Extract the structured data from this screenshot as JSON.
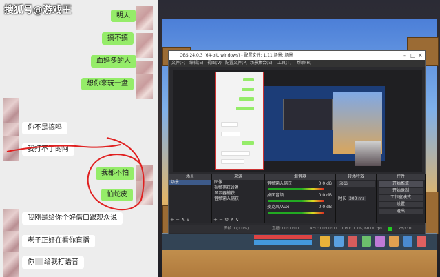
{
  "watermark": "搜狐号@游戏王",
  "chat": {
    "messages": [
      {
        "side": "out",
        "text": "明天"
      },
      {
        "side": "out",
        "text": "搞不搞"
      },
      {
        "side": "out",
        "text": "血妈多的人"
      },
      {
        "side": "out",
        "text": "想你来玩一盘"
      },
      {
        "side": "in",
        "text": ""
      },
      {
        "side": "in",
        "text": "你不是搞吗"
      },
      {
        "side": "in",
        "text": "我打不了的阿"
      },
      {
        "side": "out",
        "text": "我都不怕"
      },
      {
        "side": "out",
        "text": "怕蛇皮"
      },
      {
        "side": "in",
        "text": "我刚是给你个好借口跟观众说"
      },
      {
        "side": "in",
        "text": "老子正好在看你直播"
      },
      {
        "side": "in",
        "text": "你",
        "text2": "给我打语音"
      }
    ]
  },
  "obs": {
    "title": "OBS 24.0.3 (64-bit, windows) - 配置文件: 1.11 场景: 场景",
    "menu": [
      "文件(F)",
      "编辑(E)",
      "视图(V)",
      "配置文件(P)",
      "场景集合(S)",
      "工具(T)",
      "帮助(H)"
    ],
    "docks": {
      "scenes": {
        "header": "场景",
        "items": [
          "场景"
        ]
      },
      "sources": {
        "header": "来源",
        "items": [
          "图像",
          "视频捕获设备",
          "显示器捕获",
          "音频输入捕获"
        ]
      },
      "mixer": {
        "header": "混音器",
        "channels": [
          {
            "name": "音频输入捕获",
            "db": "0.0 dB"
          },
          {
            "name": "桌面音频",
            "db": "0.0 dB"
          },
          {
            "name": "麦克风/Aux",
            "db": "0.0 dB"
          }
        ]
      },
      "transitions": {
        "header": "转场特效",
        "type": "淡出",
        "duration_label": "时长",
        "duration": "300 ms"
      },
      "controls": {
        "header": "控件",
        "buttons": [
          "开始推流",
          "开始录制",
          "工作室模式",
          "设置",
          "退出"
        ]
      }
    },
    "status": {
      "dropped": "丢帧 0 (0.0%)",
      "live": "直播: 00:00:00",
      "rec": "REC: 00:00:00",
      "cpu": "CPU: 0.3%, 60.00 fps",
      "kbps": "kb/s: 0"
    },
    "scene_footer": "+ − ∧ ∨",
    "sources_footer": "+ − ⚙ ∧ ∨"
  },
  "colors": {
    "bubble_out": "#95ec69",
    "bubble_in": "#ffffff",
    "scribble": "#e02020",
    "obs_bg": "#2a2a2e"
  }
}
